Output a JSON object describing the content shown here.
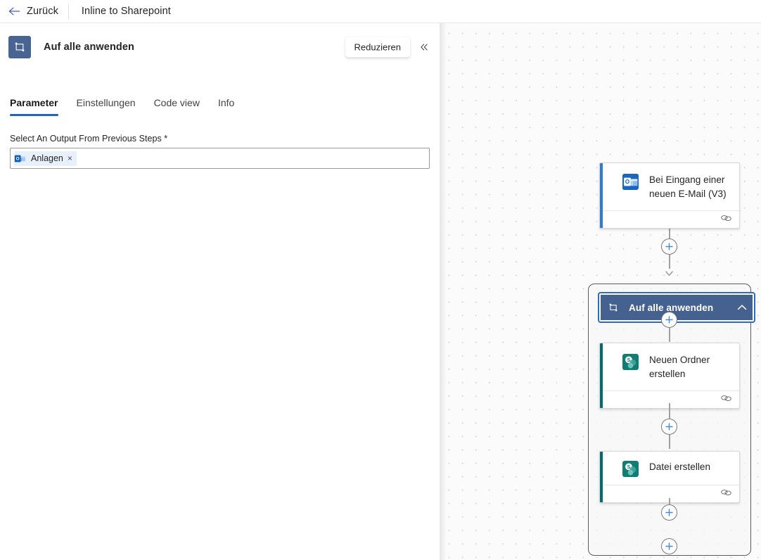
{
  "topbar": {
    "back_label": "Zurück",
    "back_icon": "arrow-left-icon",
    "flow_title": "Inline to Sharepoint"
  },
  "panel": {
    "badge_icon": "foreach-loop-icon",
    "title": "Auf alle anwenden",
    "tooltip": "Reduzieren",
    "collapse_icon": "double-chevron-left-icon",
    "tabs": [
      {
        "label": "Parameter",
        "active": true
      },
      {
        "label": "Einstellungen",
        "active": false
      },
      {
        "label": "Code view",
        "active": false
      },
      {
        "label": "Info",
        "active": false
      }
    ],
    "field": {
      "label": "Select An Output From Previous Steps *",
      "token": {
        "icon": "outlook-icon",
        "text": "Anlagen",
        "remove": "×"
      }
    }
  },
  "canvas": {
    "nodes": [
      {
        "id": "trigger",
        "title": "Bei Eingang einer neuen E-Mail (V3)",
        "icon": "outlook-icon",
        "accent_color": "#2b7cd3",
        "footer_icon": "link-icon"
      },
      {
        "id": "scope",
        "title": "Auf alle anwenden",
        "icon": "foreach-loop-icon",
        "chevron": "chevron-up-icon",
        "selected": true,
        "fill_color": "#44618f"
      },
      {
        "id": "create-folder",
        "title": "Neuen Ordner erstellen",
        "icon": "sharepoint-icon",
        "accent_color": "#036c70",
        "footer_icon": "link-icon"
      },
      {
        "id": "create-file",
        "title": "Datei erstellen",
        "icon": "sharepoint-icon",
        "accent_color": "#036c70",
        "footer_icon": "link-icon"
      }
    ],
    "add_buttons": [
      {
        "id": "add-after-trigger",
        "label": "+"
      },
      {
        "id": "add-inside-scope-top",
        "label": "+"
      },
      {
        "id": "add-between-sharepoint",
        "label": "+"
      },
      {
        "id": "add-inside-scope-bottom",
        "label": "+"
      },
      {
        "id": "add-after-scope",
        "label": "+"
      }
    ]
  }
}
